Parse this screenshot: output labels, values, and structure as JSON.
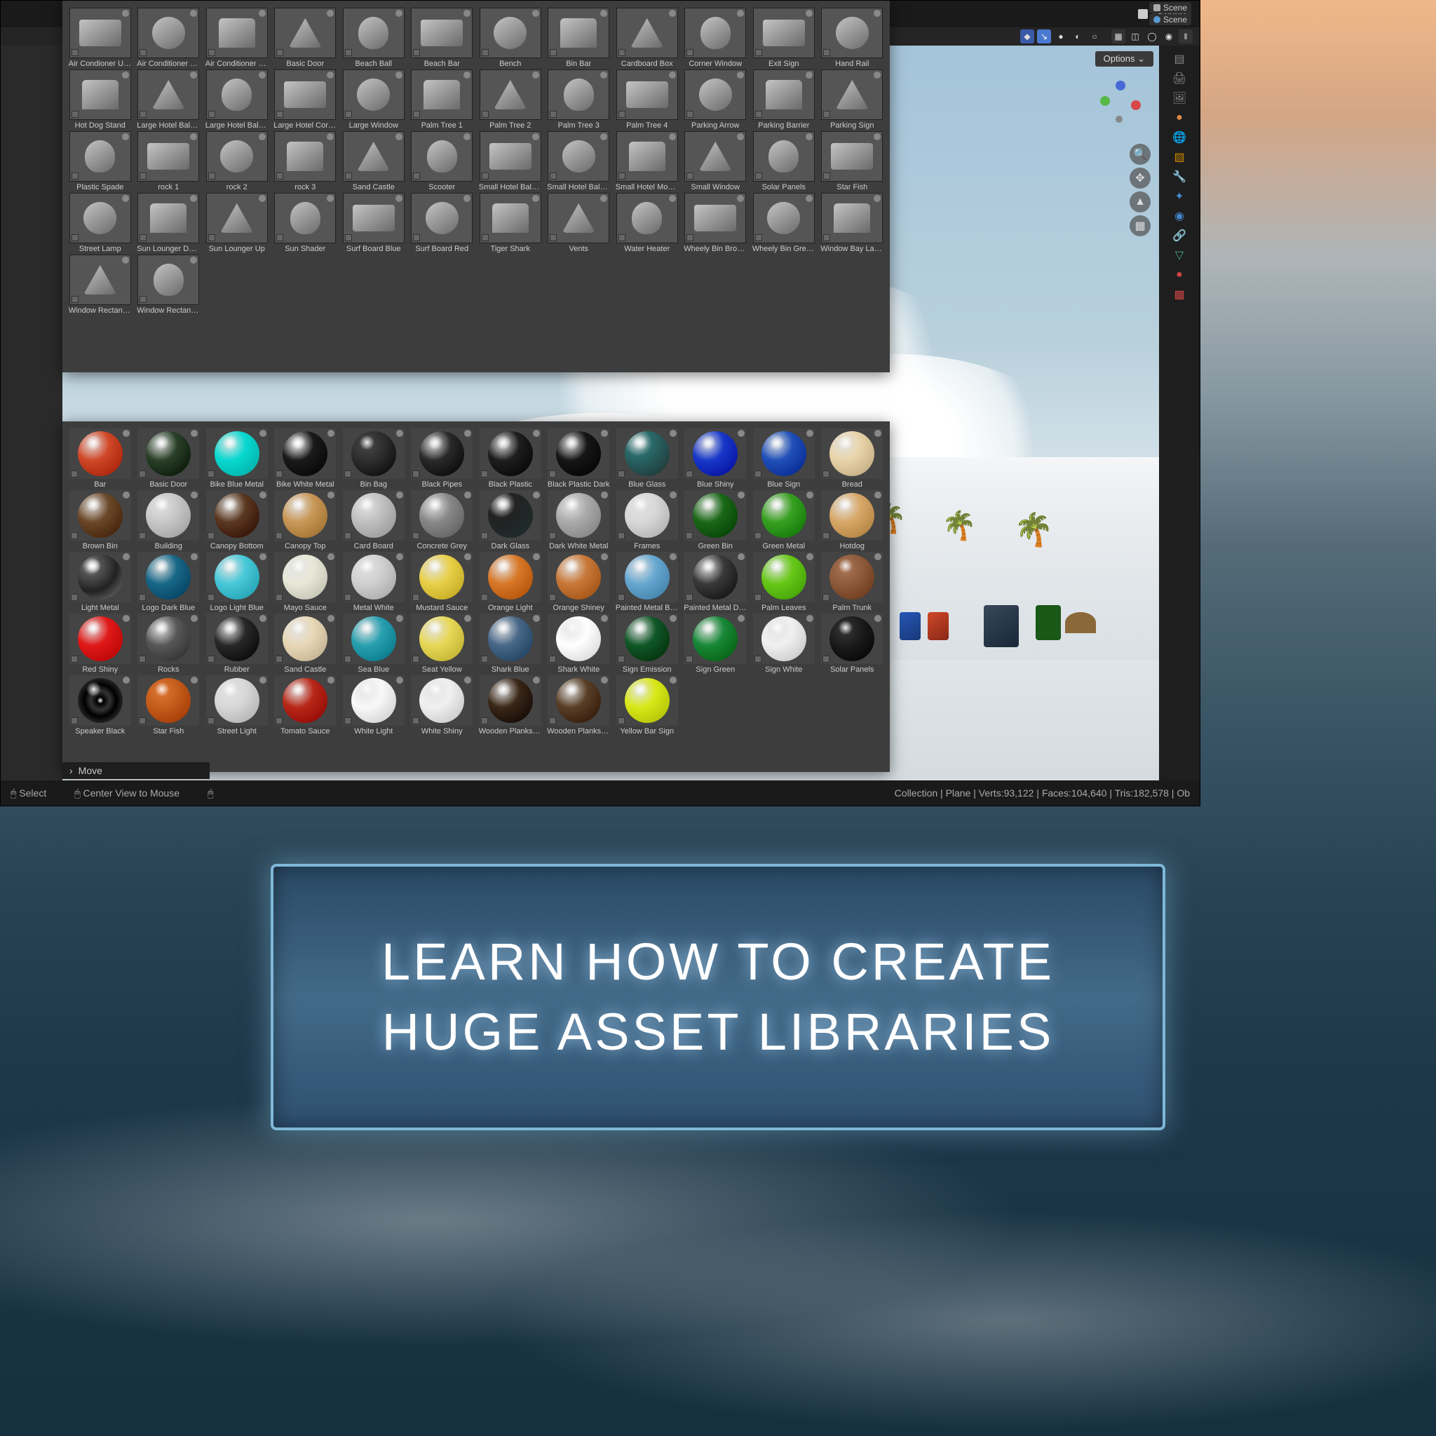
{
  "topbar": {
    "scene1": "Scene",
    "scene2": "Scene",
    "options": "Options"
  },
  "movebar": {
    "chev": "›",
    "move": "Move"
  },
  "status": {
    "select": "Select",
    "center": "Center View to Mouse",
    "info": "Collection | Plane | Verts:93,122 | Faces:104,640 | Tris:182,578 | Ob"
  },
  "banner": {
    "line1": "LEARN HOW TO CREATE",
    "line2": "HUGE ASSET LIBRARIES"
  },
  "assets": [
    {
      "l": "Air Condioner Unit ..."
    },
    {
      "l": "Air Conditioner Uni..."
    },
    {
      "l": "Air Conditioner Uni..."
    },
    {
      "l": "Basic Door"
    },
    {
      "l": "Beach Ball"
    },
    {
      "l": "Beach Bar"
    },
    {
      "l": "Bench"
    },
    {
      "l": "Bin Bar"
    },
    {
      "l": "Cardboard Box"
    },
    {
      "l": "Corner Window"
    },
    {
      "l": "Exit Sign"
    },
    {
      "l": "Hand Rail"
    },
    {
      "l": "Hot Dog Stand"
    },
    {
      "l": "Large Hotel Balcon..."
    },
    {
      "l": "Large Hotel Balcon..."
    },
    {
      "l": "Large Hotel Corner..."
    },
    {
      "l": "Large Window"
    },
    {
      "l": "Palm Tree 1"
    },
    {
      "l": "Palm Tree 2"
    },
    {
      "l": "Palm Tree 3"
    },
    {
      "l": "Palm Tree 4"
    },
    {
      "l": "Parking Arrow"
    },
    {
      "l": "Parking Barrier"
    },
    {
      "l": "Parking Sign"
    },
    {
      "l": "Plastic Spade"
    },
    {
      "l": "rock 1"
    },
    {
      "l": "rock 2"
    },
    {
      "l": "rock 3"
    },
    {
      "l": "Sand Castle"
    },
    {
      "l": "Scooter"
    },
    {
      "l": "Small Hotel Balcon..."
    },
    {
      "l": "Small Hotel Balcon..."
    },
    {
      "l": "Small Hotel Moder..."
    },
    {
      "l": "Small Window"
    },
    {
      "l": "Solar Panels"
    },
    {
      "l": "Star Fish"
    },
    {
      "l": "Street Lamp"
    },
    {
      "l": "Sun Lounger Down"
    },
    {
      "l": "Sun Lounger Up"
    },
    {
      "l": "Sun Shader"
    },
    {
      "l": "Surf Board Blue"
    },
    {
      "l": "Surf Board Red"
    },
    {
      "l": "Tiger Shark"
    },
    {
      "l": "Vents"
    },
    {
      "l": "Water Heater"
    },
    {
      "l": "Wheely Bin Brown ..."
    },
    {
      "l": "Wheely Bin Green ..."
    },
    {
      "l": "Window Bay Large"
    },
    {
      "l": "Window Rectangle..."
    },
    {
      "l": "Window Rectangle..."
    }
  ],
  "materials": [
    {
      "l": "Bar",
      "c": "#d04828"
    },
    {
      "l": "Basic Door",
      "c": "#2a4028"
    },
    {
      "l": "Bike Blue Metal",
      "c": "#08d8d0"
    },
    {
      "l": "Bike White Metal",
      "c": "#1a1a1a",
      "s": "#fff"
    },
    {
      "l": "Bin Bag",
      "c": "#2a2a2a",
      "t": "rough"
    },
    {
      "l": "Black Pipes",
      "c": "#2a2a2a"
    },
    {
      "l": "Black Plastic",
      "c": "#1e1e1e"
    },
    {
      "l": "Black Plastic Dark",
      "c": "#161616"
    },
    {
      "l": "Blue Glass",
      "c": "#2a6a6a",
      "t": "glass"
    },
    {
      "l": "Blue Shiny",
      "c": "#1838c8"
    },
    {
      "l": "Blue Sign",
      "c": "#2050b8"
    },
    {
      "l": "Bread",
      "c": "#e8d4a8"
    },
    {
      "l": "Brown Bin",
      "c": "#6a4828"
    },
    {
      "l": "Building",
      "c": "#c8c8c8"
    },
    {
      "l": "Canopy Bottom",
      "c": "#5a3820"
    },
    {
      "l": "Canopy Top",
      "c": "#c89858"
    },
    {
      "l": "Card Board",
      "c": "#c0c0c0"
    },
    {
      "l": "Concrete Grey",
      "c": "#888"
    },
    {
      "l": "Dark Glass",
      "c": "#222",
      "t": "glass"
    },
    {
      "l": "Dark White Metal",
      "c": "#aaa"
    },
    {
      "l": "Frames",
      "c": "#d8d8d8"
    },
    {
      "l": "Green Bin",
      "c": "#1a6818"
    },
    {
      "l": "Green Metal",
      "c": "#38a020"
    },
    {
      "l": "Hotdog",
      "c": "#d8a868"
    },
    {
      "l": "Light Metal",
      "c": "#555",
      "t": "metal"
    },
    {
      "l": "Logo Dark Blue",
      "c": "#186888"
    },
    {
      "l": "Logo Light Blue",
      "c": "#48c8d8"
    },
    {
      "l": "Mayo Sauce",
      "c": "#e8e8d8"
    },
    {
      "l": "Metal White",
      "c": "#d0d0d0"
    },
    {
      "l": "Mustard Sauce",
      "c": "#e8d048"
    },
    {
      "l": "Orange Light",
      "c": "#d87828"
    },
    {
      "l": "Orange Shiney",
      "c": "#c87838"
    },
    {
      "l": "Painted Metal Blue",
      "c": "#68a8d0"
    },
    {
      "l": "Painted Metal Dark",
      "c": "#3a3a3a"
    },
    {
      "l": "Palm Leaves",
      "c": "#68c818"
    },
    {
      "l": "Palm Trunk",
      "c": "#8a5838",
      "t": "rough"
    },
    {
      "l": "Red Shiny",
      "c": "#e01818"
    },
    {
      "l": "Rocks",
      "c": "#585858"
    },
    {
      "l": "Rubber",
      "c": "#282828"
    },
    {
      "l": "Sand Castle",
      "c": "#e8d8b8"
    },
    {
      "l": "Sea Blue",
      "c": "#28a0b0"
    },
    {
      "l": "Seat Yellow",
      "c": "#e8d858"
    },
    {
      "l": "Shark Blue",
      "c": "#486888"
    },
    {
      "l": "Shark White",
      "c": "#ffffff"
    },
    {
      "l": "Sign Emission",
      "c": "#105828"
    },
    {
      "l": "Sign Green",
      "c": "#188838"
    },
    {
      "l": "Sign White",
      "c": "#f0f0f0"
    },
    {
      "l": "Solar Panels",
      "c": "#181818",
      "t": "rough"
    },
    {
      "l": "Speaker Black",
      "c": "#1a1a1a",
      "t": "ring"
    },
    {
      "l": "Star Fish",
      "c": "#c05818",
      "t": "rough"
    },
    {
      "l": "Street Light",
      "c": "#d8d8d8"
    },
    {
      "l": "Tomato Sauce",
      "c": "#b82818"
    },
    {
      "l": "White Light",
      "c": "#f8f8f8"
    },
    {
      "l": "White Shiny",
      "c": "#f0f0f0"
    },
    {
      "l": "Wooden Planks Ra...",
      "c": "#3a2818"
    },
    {
      "l": "Wooden Planks Ra...",
      "c": "#5a4028"
    },
    {
      "l": "Yellow Bar Sign",
      "c": "#d8e818"
    }
  ]
}
